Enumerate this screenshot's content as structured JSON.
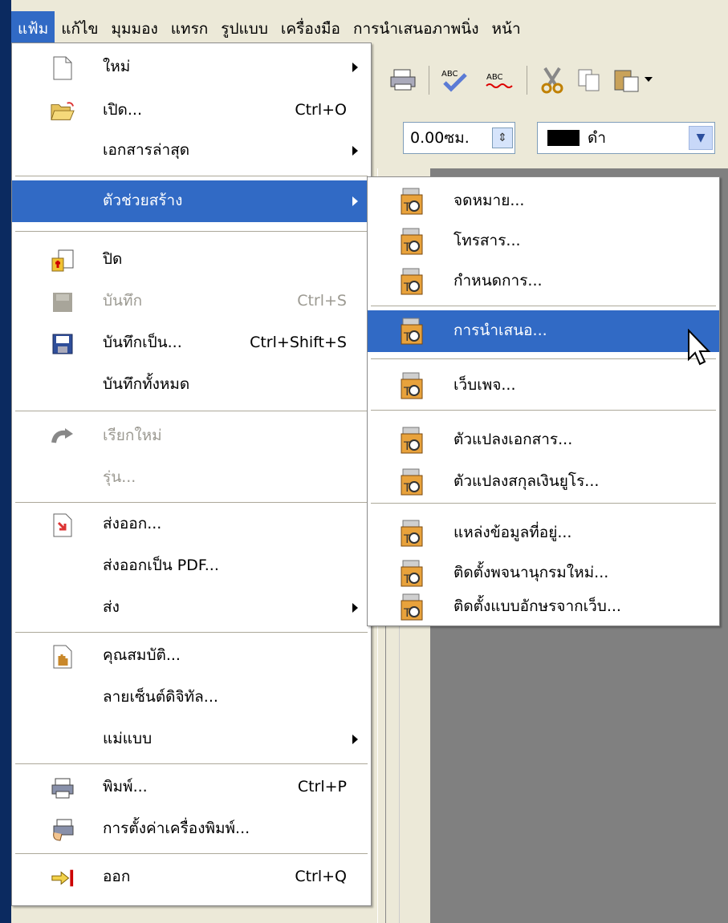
{
  "menubar": {
    "items": [
      {
        "label": "แฟ้ม",
        "active": true
      },
      {
        "label": "แก้ไข"
      },
      {
        "label": "มุมมอง"
      },
      {
        "label": "แทรก"
      },
      {
        "label": "รูปแบบ"
      },
      {
        "label": "เครื่องมือ"
      },
      {
        "label": "การนำเสนอภาพนิ่ง"
      },
      {
        "label": "หน้า"
      }
    ]
  },
  "toolbar": {
    "line_width": "0.00ซม.",
    "line_color_name": "ดำ",
    "line_color": "#000000"
  },
  "file_menu": {
    "items": [
      {
        "label": "ใหม่",
        "icon": "new-document-icon",
        "has_submenu": true
      },
      {
        "label": "เปิด...",
        "icon": "open-folder-icon",
        "shortcut": "Ctrl+O"
      },
      {
        "label": "เอกสารล่าสุด",
        "has_submenu": true
      },
      {
        "label": "ตัวช่วยสร้าง",
        "has_submenu": true,
        "highlighted": true
      },
      {
        "label": "ปิด",
        "icon": "close-document-icon"
      },
      {
        "label": "บันทึก",
        "icon": "save-icon",
        "shortcut": "Ctrl+S",
        "disabled": true
      },
      {
        "label": "บันทึกเป็น...",
        "icon": "save-as-icon",
        "shortcut": "Ctrl+Shift+S"
      },
      {
        "label": "บันทึกทั้งหมด"
      },
      {
        "label": "เรียกใหม่",
        "icon": "reload-icon",
        "disabled": true
      },
      {
        "label": "รุ่น...",
        "disabled": true
      },
      {
        "label": "ส่งออก...",
        "icon": "export-icon"
      },
      {
        "label": "ส่งออกเป็น PDF..."
      },
      {
        "label": "ส่ง",
        "has_submenu": true
      },
      {
        "label": "คุณสมบัติ...",
        "icon": "properties-icon"
      },
      {
        "label": "ลายเซ็นต์ดิจิทัล..."
      },
      {
        "label": "แม่แบบ",
        "has_submenu": true
      },
      {
        "label": "พิมพ์...",
        "icon": "printer-icon",
        "shortcut": "Ctrl+P"
      },
      {
        "label": "การตั้งค่าเครื่องพิมพ์...",
        "icon": "printer-settings-icon"
      },
      {
        "label": "ออก",
        "icon": "exit-icon",
        "shortcut": "Ctrl+Q"
      }
    ]
  },
  "wizards_menu": {
    "items": [
      {
        "label": "จดหมาย..."
      },
      {
        "label": "โทรสาร..."
      },
      {
        "label": "กำหนดการ..."
      },
      {
        "label": "การนำเสนอ...",
        "highlighted": true
      },
      {
        "label": "เว็บเพจ..."
      },
      {
        "label": "ตัวแปลงเอกสาร..."
      },
      {
        "label": "ตัวแปลงสกุลเงินยูโร..."
      },
      {
        "label": "แหล่งข้อมูลที่อยู่..."
      },
      {
        "label": "ติดตั้งพจนานุกรมใหม่..."
      },
      {
        "label": "ติดตั้งแบบอักษรจากเว็บ..."
      }
    ]
  }
}
